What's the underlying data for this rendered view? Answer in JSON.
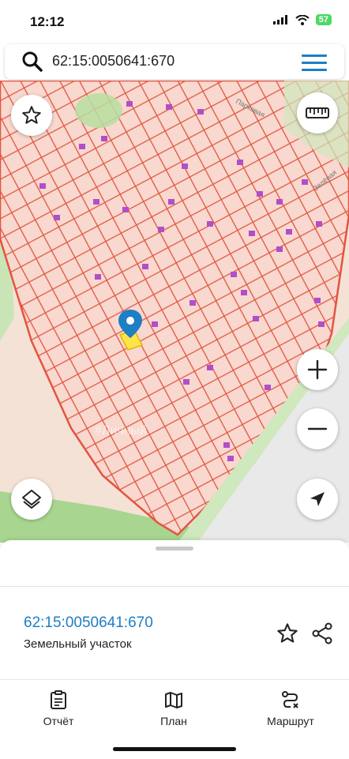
{
  "status_bar": {
    "time": "12:12",
    "battery": "57"
  },
  "search": {
    "query": "62:15:0050641:670"
  },
  "map": {
    "street_labels": [
      "Парковая",
      "Зелёная"
    ],
    "watermark": "#Личный"
  },
  "sheet": {
    "cadastral_number": "62:15:0050641:670",
    "property_type": "Земельный участок"
  },
  "tabs": [
    {
      "label": "Отчёт",
      "icon": "report-icon"
    },
    {
      "label": "План",
      "icon": "map-icon"
    },
    {
      "label": "Маршрут",
      "icon": "route-icon"
    }
  ],
  "colors": {
    "accent": "#1d7fc4",
    "parcel_line": "#e2553f",
    "parcel_fill": "#f8d8cf",
    "building": "#b14fc9",
    "green": "#b9dfa0"
  }
}
